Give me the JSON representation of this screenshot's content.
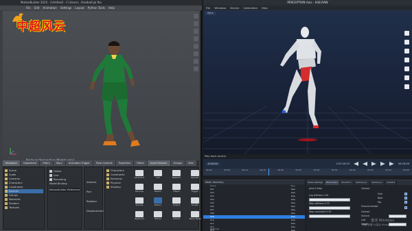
{
  "left_app": {
    "title": "MotionBuilder 2015 - [Untitled] - C:\\Users\\...\\football\\jal.fbx",
    "menu": [
      "File",
      "Edit",
      "Animation",
      "Settings",
      "Layout",
      "Python Tools",
      "Help"
    ],
    "logo_text": "中超风云",
    "viewport_label": "Producer Perspective (Models only)",
    "bottom_tabs": [
      "Navigator",
      "Dopesheet",
      "Filters",
      "Story",
      "Animation Trigger",
      "Pose Controls",
      "Properties",
      "Filters",
      "Asset Browser",
      "Groups",
      "Sets"
    ],
    "active_tab": "Navigator",
    "tree_items": [
      "Scene",
      "Audio",
      "Cameras",
      "Characters",
      "Constraints",
      "Devices",
      "Groups",
      "Materials",
      "Shaders",
      "Textures"
    ],
    "device_panel": {
      "title": "Online",
      "rows": [
        "Live",
        "Recording",
        "Model Binding"
      ],
      "field": "MotionBuilder Reference"
    },
    "mid_panel_labels": [
      "Address",
      "Port",
      "Rotation",
      "Displacement"
    ],
    "assets": [
      [
        "Characters",
        "General P.",
        "GUI",
        "Network"
      ],
      [
        "Constraints",
        "Devices",
        "Motion",
        "OpenGL"
      ],
      [
        "Elements",
        "Filters",
        "Mouse",
        "Trigger"
      ],
      [
        "Physical",
        "Solvers",
        "Output",
        "Scripts"
      ],
      [
        "Shading",
        "Keyboard",
        "Mouse",
        "Sound",
        "Wave Table"
      ]
    ],
    "selected_asset": "Motion"
  },
  "right_app": {
    "title": "PERCEPTION Axis - 048.RAW",
    "menu": [
      "File",
      "Windows",
      "Device",
      "Calibration",
      "Help"
    ],
    "toolbar_label": "Sync",
    "playback_label": "Play back control",
    "time_left": "0:00:00",
    "time_mid": "1:07:20:19",
    "time_right": "09:20:00",
    "timeline_marks": [
      "00:00",
      "00:05",
      "00:10",
      "00:15",
      "00:20",
      "00:25",
      "00:30",
      "00:35",
      "00:40",
      "00:45",
      "00:50",
      "00:55"
    ],
    "motion_window": {
      "title": "Mesh directory",
      "columns": [
        "Name",
        "Type"
      ],
      "rows": [
        [
          "001",
          "Raw"
        ],
        [
          "002",
          "Raw"
        ],
        [
          "003",
          "Raw"
        ],
        [
          "004",
          "Raw"
        ],
        [
          "005",
          "Raw"
        ],
        [
          "006",
          "Raw"
        ],
        [
          "007",
          "Raw"
        ],
        [
          "008",
          "Raw"
        ],
        [
          "009",
          "Raw"
        ],
        [
          "010",
          "Raw"
        ],
        [
          "011",
          "Raw"
        ],
        [
          "012",
          "Raw"
        ],
        [
          "013",
          "Raw"
        ]
      ],
      "selected_row": 8,
      "footer": "Start run"
    },
    "parameters": {
      "title": "Parameters",
      "tabs": [
        "Model settings",
        "Parameters",
        "Smooth f...",
        "Kalman pr...",
        "Kalman p...",
        "Contact"
      ],
      "group_left": "Joint & Step",
      "fields": [
        "Leg stiffness 1.00",
        "Step stiffness 0.70",
        "Step constraint 0.30"
      ],
      "group_right": "Contact",
      "checks": [
        "Feet",
        "Both",
        "Hip",
        "Ground contact"
      ],
      "bottom_fields": [
        "Contact",
        "Ground",
        "Left",
        "Height"
      ]
    },
    "watermark": [
      "激活 Windows",
      "转到\"设置\"以激活 Windows。"
    ]
  }
}
